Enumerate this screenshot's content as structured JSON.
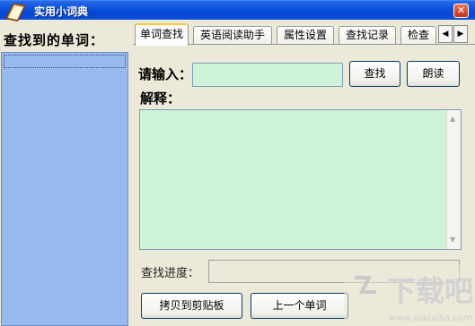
{
  "window": {
    "title": "实用小词典",
    "close_glyph": "✕"
  },
  "left_panel": {
    "label": "查找到的单词："
  },
  "tabs": [
    {
      "label": "单词查找"
    },
    {
      "label": "英语阅读助手"
    },
    {
      "label": "属性设置"
    },
    {
      "label": "查找记录"
    },
    {
      "label": "检查"
    }
  ],
  "tab_scroll": {
    "left": "◀",
    "right": "▶"
  },
  "lookup": {
    "input_label": "请输入：",
    "input_value": "",
    "search_button": "查找",
    "read_button": "朗读",
    "explain_label": "解释：",
    "explain_value": "",
    "progress_label": "查找进度："
  },
  "bottom_buttons": {
    "copy": "拷贝到剪贴板",
    "prev_word": "上一个单词"
  },
  "watermark": {
    "text": "下载吧",
    "url": "www.xiazaiba.com"
  },
  "colors": {
    "titlebar": "#0a4fdc",
    "list_bg": "#97b9ee",
    "field_bg": "#cff3d6",
    "window_bg": "#ece9d8"
  }
}
